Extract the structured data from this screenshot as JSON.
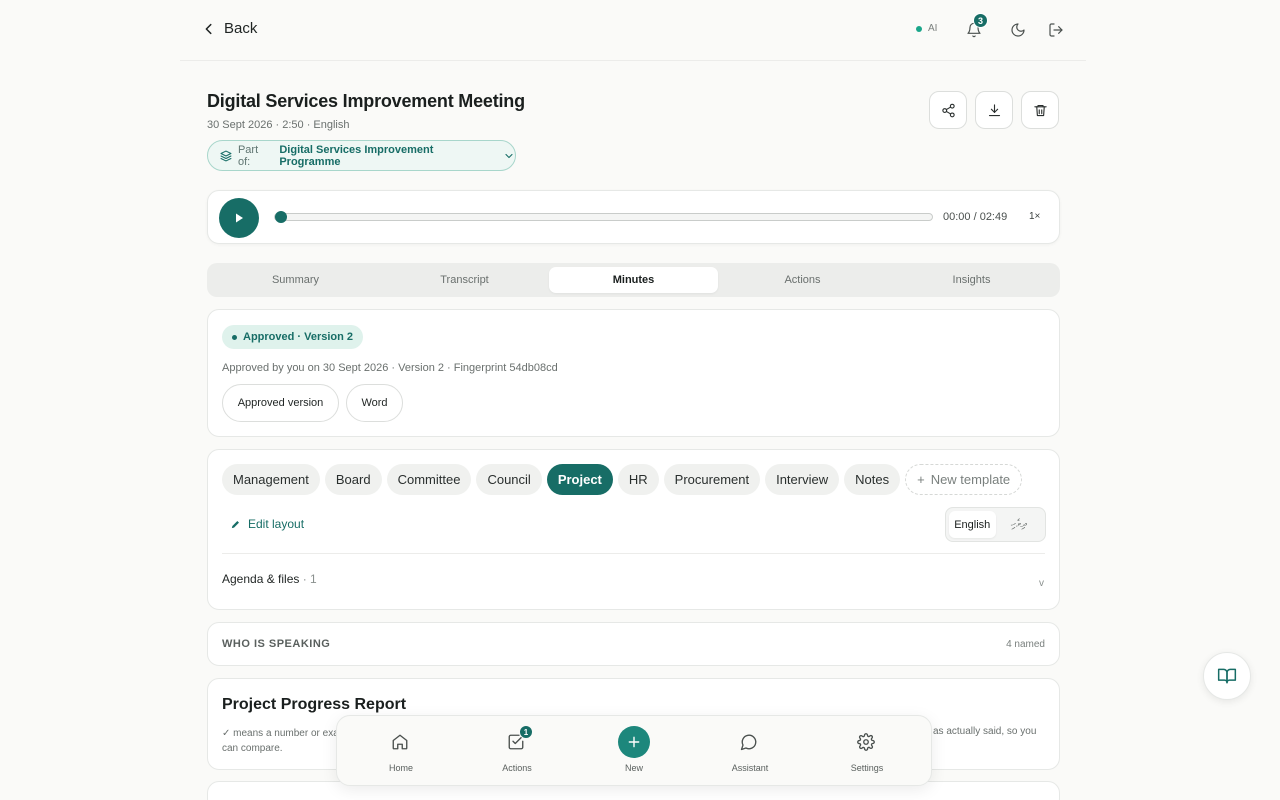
{
  "topbar": {
    "back_label": "Back",
    "ai_label": "AI",
    "notification_count": "3"
  },
  "meeting": {
    "title": "Digital Services Improvement Meeting",
    "meta": "30 Sept 2026 · 2:50 · English",
    "part_of_label": "Part of:",
    "part_of_value": "Digital Services Improvement Programme"
  },
  "player": {
    "time": "00:00 / 02:49",
    "speed": "1×",
    "progress": 0
  },
  "tabs": [
    {
      "label": "Summary",
      "active": false
    },
    {
      "label": "Transcript",
      "active": false
    },
    {
      "label": "Minutes",
      "active": true
    },
    {
      "label": "Actions",
      "active": false
    },
    {
      "label": "Insights",
      "active": false
    }
  ],
  "approval": {
    "badge": "Approved · Version 2",
    "note": "Approved by you on 30 Sept 2026 · Version 2 · Fingerprint 54db08cd",
    "approved_version_label": "Approved version",
    "word_label": "Word"
  },
  "templates": {
    "items": [
      "Management",
      "Board",
      "Committee",
      "Council",
      "Project",
      "HR",
      "Procurement",
      "Interview",
      "Notes"
    ],
    "active": "Project",
    "new_label": "New template",
    "edit_layout_label": "Edit layout",
    "languages": [
      "English",
      "ދިވެހި"
    ],
    "active_language": "English",
    "agenda_label": "Agenda & files",
    "agenda_count": " · 1",
    "agenda_chevron": "v"
  },
  "speakers": {
    "title": "WHO IS SPEAKING",
    "count": "4 named"
  },
  "report": {
    "title": "Project Progress Report",
    "note_left": "✓ means a number or exa",
    "note_left_2": "can compare.",
    "note_right": "as actually said, so you"
  },
  "bottom_nav": {
    "home": "Home",
    "actions": "Actions",
    "actions_badge": "1",
    "new": "New",
    "assistant": "Assistant",
    "settings": "Settings"
  },
  "colors": {
    "accent": "#176d66",
    "accent_light": "#dff2ec"
  }
}
